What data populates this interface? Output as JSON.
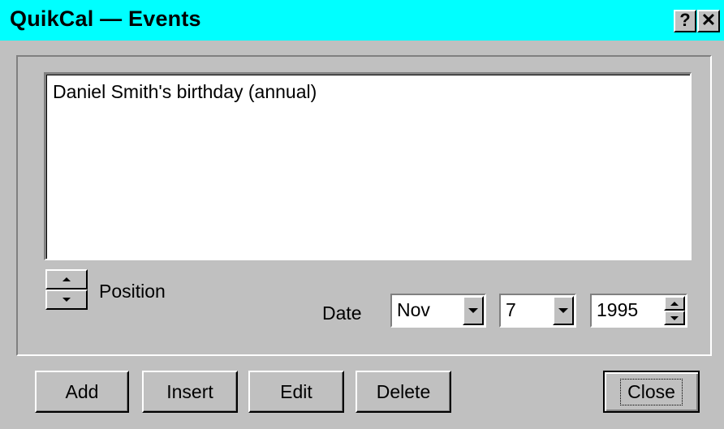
{
  "window": {
    "title": "QuikCal — Events",
    "help_label": "?",
    "close_label": "✕"
  },
  "events_list": {
    "items": [
      "Daniel Smith's birthday (annual)"
    ]
  },
  "position": {
    "label": "Position"
  },
  "date": {
    "label": "Date",
    "month": "Nov",
    "day": "7",
    "year": "1995"
  },
  "buttons": {
    "add": "Add",
    "insert": "Insert",
    "edit": "Edit",
    "delete": "Delete",
    "close": "Close"
  },
  "colors": {
    "title_bar": "#00ffff",
    "face": "#c0c0c0"
  }
}
